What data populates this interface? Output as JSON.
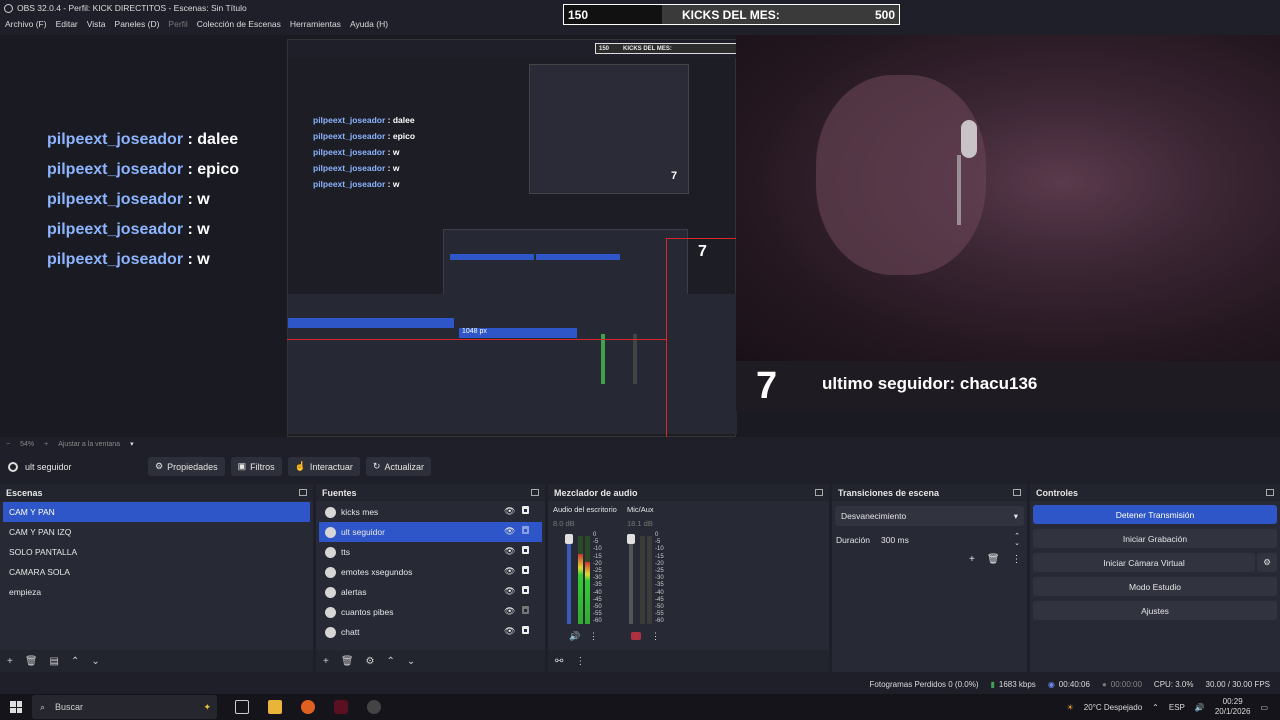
{
  "window": {
    "title": "OBS 32.0.4 - Perfil: KICK DIRECTITOS - Escenas: Sin Título"
  },
  "menu": [
    "Archivo (F)",
    "Editar",
    "Vista",
    "Paneles (D)",
    "Perfil",
    "Colección de Escenas",
    "Herramientas",
    "Ayuda (H)"
  ],
  "preview": {
    "chat": [
      {
        "user": "pilpeext_joseador",
        "msg": ": dalee"
      },
      {
        "user": "pilpeext_joseador",
        "msg": ": epico"
      },
      {
        "user": "pilpeext_joseador",
        "msg": ": w"
      },
      {
        "user": "pilpeext_joseador",
        "msg": ": w"
      },
      {
        "user": "pilpeext_joseador",
        "msg": ": w"
      }
    ],
    "kicks": {
      "left": "150",
      "label": "KICKS DEL MES:",
      "right": "500"
    },
    "counter": "7",
    "follower": "ultimo seguidor: chacu136",
    "px_label": "1048 px",
    "nested_kicks": {
      "left": "150",
      "label": "KICKS DEL MES:"
    }
  },
  "zoom": {
    "value": "54%",
    "fit": "Ajustar a la ventana"
  },
  "source_toolbar": {
    "source_name": "ult seguidor",
    "buttons": [
      "Propiedades",
      "Filtros",
      "Interactuar",
      "Actualizar"
    ]
  },
  "scenes": {
    "title": "Escenas",
    "items": [
      "CAM Y PAN",
      "CAM Y PAN IZQ",
      "SOLO PANTALLA",
      "CAMARA SOLA",
      "empieza"
    ],
    "selected": 0
  },
  "sources": {
    "title": "Fuentes",
    "items": [
      "kicks mes",
      "ult seguidor",
      "tts",
      "emotes xsegundos",
      "alertas",
      "cuantos pibes",
      "chatt"
    ],
    "selected": 1
  },
  "mixer": {
    "title": "Mezclador de audio",
    "channels": [
      {
        "name": "Audio del escritorio",
        "db": "8.0 dB",
        "level": 0.55
      },
      {
        "name": "Mic/Aux",
        "db": "18.1 dB",
        "level": 0.0
      }
    ],
    "scale": [
      "0",
      "-5",
      "-10",
      "-15",
      "-20",
      "-25",
      "-30",
      "-35",
      "-40",
      "-45",
      "-50",
      "-55",
      "-60"
    ]
  },
  "transitions": {
    "title": "Transiciones de escena",
    "selected": "Desvanecimiento",
    "duration_label": "Duración",
    "duration_value": "300 ms"
  },
  "controls": {
    "title": "Controles",
    "buttons": [
      "Detener Transmisión",
      "Iniciar Grabación",
      "Iniciar Cámara Virtual",
      "Modo Estudio",
      "Ajustes"
    ]
  },
  "status": {
    "dropped": "Fotogramas Perdidos 0 (0.0%)",
    "bitrate": "1683 kbps",
    "stream_time": "00:40:06",
    "rec_time": "00:00:00",
    "cpu": "CPU: 3.0%",
    "fps": "30.00 / 30.00 FPS"
  },
  "taskbar": {
    "search": "Buscar",
    "weather": "20°C  Despejado",
    "lang": "ESP",
    "time": "00:29",
    "date": "20/1/2026"
  },
  "colors": {
    "accent": "#2e56c9",
    "username": "#8db4ff"
  }
}
